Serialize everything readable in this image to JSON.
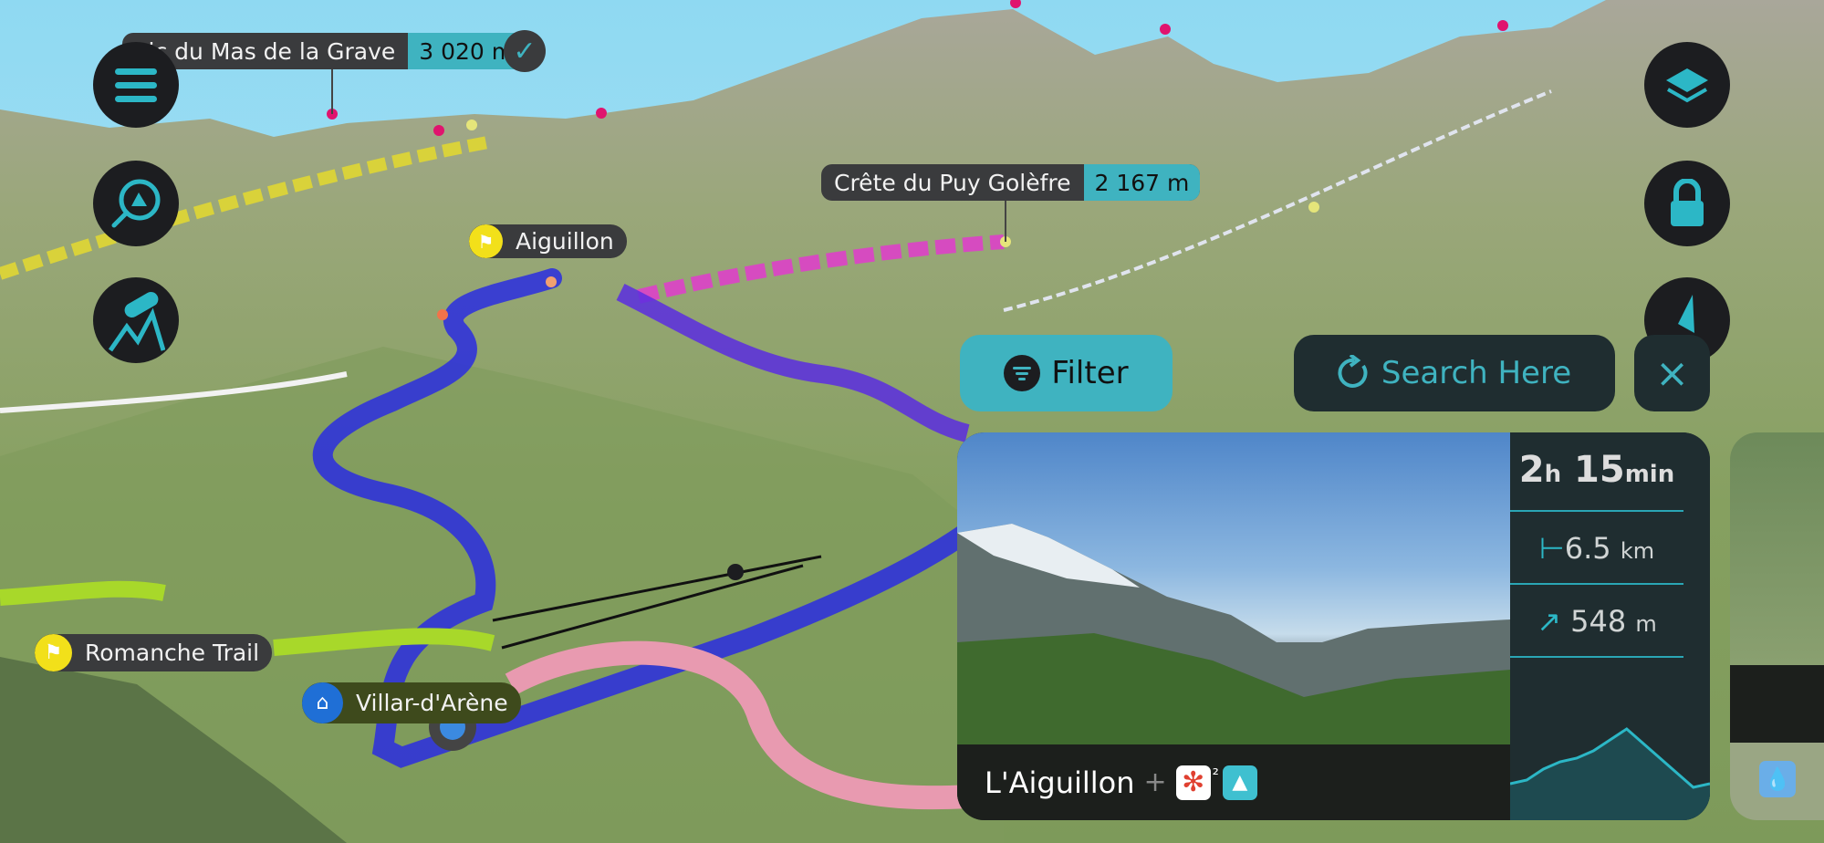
{
  "map": {
    "peaks": [
      {
        "name": "Pic du Mas de la Grave",
        "altitude": "3 020 m",
        "checked": true
      },
      {
        "name": "Crête du Puy Golèfre",
        "altitude": "2 167 m"
      }
    ],
    "places": [
      {
        "name": "Aiguillon",
        "icon": "flag-icon"
      },
      {
        "name": "Romanche Trail",
        "icon": "flag-icon"
      },
      {
        "name": "Villar-d'Arène",
        "icon": "village-icon"
      }
    ]
  },
  "left_controls": [
    "menu-icon",
    "search-map-icon",
    "telescope-icon"
  ],
  "right_controls": [
    "layers-icon",
    "lock-icon",
    "compass-icon"
  ],
  "filter": {
    "label": "Filter",
    "icon": "filter-icon"
  },
  "search_here": {
    "label": "Search Here",
    "icon": "refresh-icon"
  },
  "close": {
    "label": "×"
  },
  "card": {
    "title": "L'Aiguillon",
    "plus": "+",
    "badge_count": "²",
    "duration": {
      "h": "2",
      "h_unit": "h",
      "min": "15",
      "min_unit": "min"
    },
    "distance": {
      "value": "6.5",
      "unit": "km"
    },
    "elevation": {
      "value": "548",
      "unit": "m"
    },
    "profile": [
      0.25,
      0.3,
      0.45,
      0.55,
      0.6,
      0.7,
      0.85,
      1.0,
      0.8,
      0.6,
      0.4,
      0.2,
      0.25
    ]
  },
  "colors": {
    "accent": "#3fb3c0",
    "dark": "#1c1d20",
    "panel": "#1f2d30"
  }
}
